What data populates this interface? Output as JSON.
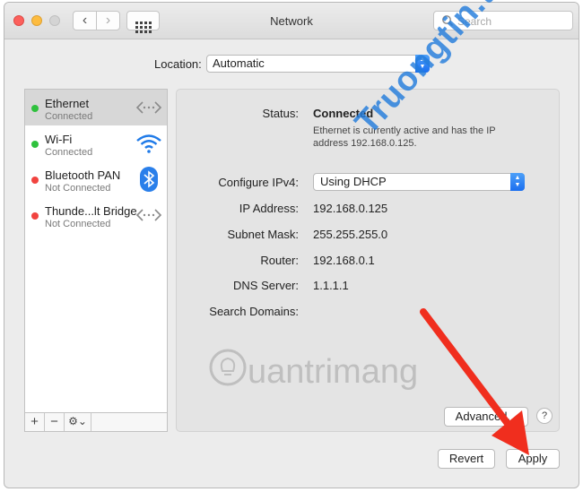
{
  "window": {
    "title": "Network"
  },
  "search": {
    "placeholder": "Search"
  },
  "location": {
    "label": "Location:",
    "value": "Automatic"
  },
  "services": [
    {
      "name": "Ethernet",
      "status": "Connected",
      "state": "connected",
      "icon": "ethernet-arrows-icon",
      "selected": true
    },
    {
      "name": "Wi-Fi",
      "status": "Connected",
      "state": "connected",
      "icon": "wifi-icon",
      "selected": false
    },
    {
      "name": "Bluetooth PAN",
      "status": "Not Connected",
      "state": "disconnected",
      "icon": "bluetooth-icon",
      "selected": false
    },
    {
      "name": "Thunde...lt Bridge",
      "status": "Not Connected",
      "state": "disconnected",
      "icon": "ethernet-arrows-icon",
      "selected": false
    }
  ],
  "toolbar": {
    "add": "+",
    "remove": "−",
    "action": "⚙︎⌄"
  },
  "detail": {
    "status_label": "Status:",
    "status_value": "Connected",
    "status_description": "Ethernet is currently active and has the IP address 192.168.0.125.",
    "configure_label": "Configure IPv4:",
    "configure_value": "Using DHCP",
    "ip_label": "IP Address:",
    "ip_value": "192.168.0.125",
    "subnet_label": "Subnet Mask:",
    "subnet_value": "255.255.255.0",
    "router_label": "Router:",
    "router_value": "192.168.0.1",
    "dns_label": "DNS Server:",
    "dns_value": "1.1.1.1",
    "search_domains_label": "Search Domains:",
    "advanced_button": "Advanced...",
    "help_button": "?"
  },
  "buttons": {
    "revert": "Revert",
    "apply": "Apply"
  },
  "watermarks": {
    "primary": "Truongtin.top",
    "secondary": "uantrimang"
  },
  "colors": {
    "accent": "#1a6ef0",
    "connected": "#2fc13d",
    "disconnected": "#f1433f",
    "annotation_arrow": "#f02e1e"
  }
}
